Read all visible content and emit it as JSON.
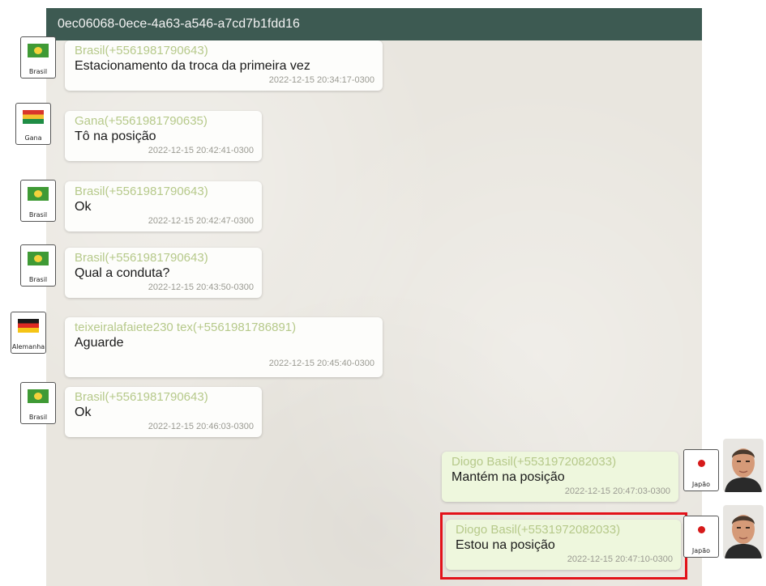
{
  "window": {
    "title": "0ec06068-0ece-4a63-a546-a7cd7b1fdd16"
  },
  "messages": [
    {
      "sender": "Brasil(+5561981790643)",
      "text": "Estacionamento da troca da primeira vez",
      "time": "2022-12-15 20:34:17-0300",
      "country": "Brasil",
      "flag": "brazil-flag-icon",
      "direction": "incoming"
    },
    {
      "sender": "Gana(+5561981790635)",
      "text": "Tô na posição",
      "time": "2022-12-15 20:42:41-0300",
      "country": "Gana",
      "flag": "ghana-flag-icon",
      "direction": "incoming"
    },
    {
      "sender": "Brasil(+5561981790643)",
      "text": "Ok",
      "time": "2022-12-15 20:42:47-0300",
      "country": "Brasil",
      "flag": "brazil-flag-icon",
      "direction": "incoming"
    },
    {
      "sender": "Brasil(+5561981790643)",
      "text": "Qual a conduta?",
      "time": "2022-12-15 20:43:50-0300",
      "country": "Brasil",
      "flag": "brazil-flag-icon",
      "direction": "incoming"
    },
    {
      "sender": "teixeiralafaiete230 tex(+5561981786891)",
      "text": "Aguarde",
      "time": "2022-12-15 20:45:40-0300",
      "country": "Alemanha",
      "flag": "germany-flag-icon",
      "direction": "incoming"
    },
    {
      "sender": "Brasil(+5561981790643)",
      "text": "Ok",
      "time": "2022-12-15 20:46:03-0300",
      "country": "Brasil",
      "flag": "brazil-flag-icon",
      "direction": "incoming"
    },
    {
      "sender": "Diogo Basil(+5531972082033)",
      "text": "Mantém na posição",
      "time": "2022-12-15 20:47:03-0300",
      "country": "Japão",
      "flag": "japan-flag-icon",
      "direction": "outgoing"
    },
    {
      "sender": "Diogo Basil(+5531972082033)",
      "text": "Estou na posição",
      "time": "2022-12-15 20:47:10-0300",
      "country": "Japão",
      "flag": "japan-flag-icon",
      "direction": "outgoing",
      "highlighted": true
    }
  ],
  "colors": {
    "title_bar": "#3d5a52",
    "chat_background": "#e9e6df",
    "sender_name": "#b6c98a",
    "outgoing_bubble": "#eef7dd",
    "highlight_border": "#e3121a"
  }
}
